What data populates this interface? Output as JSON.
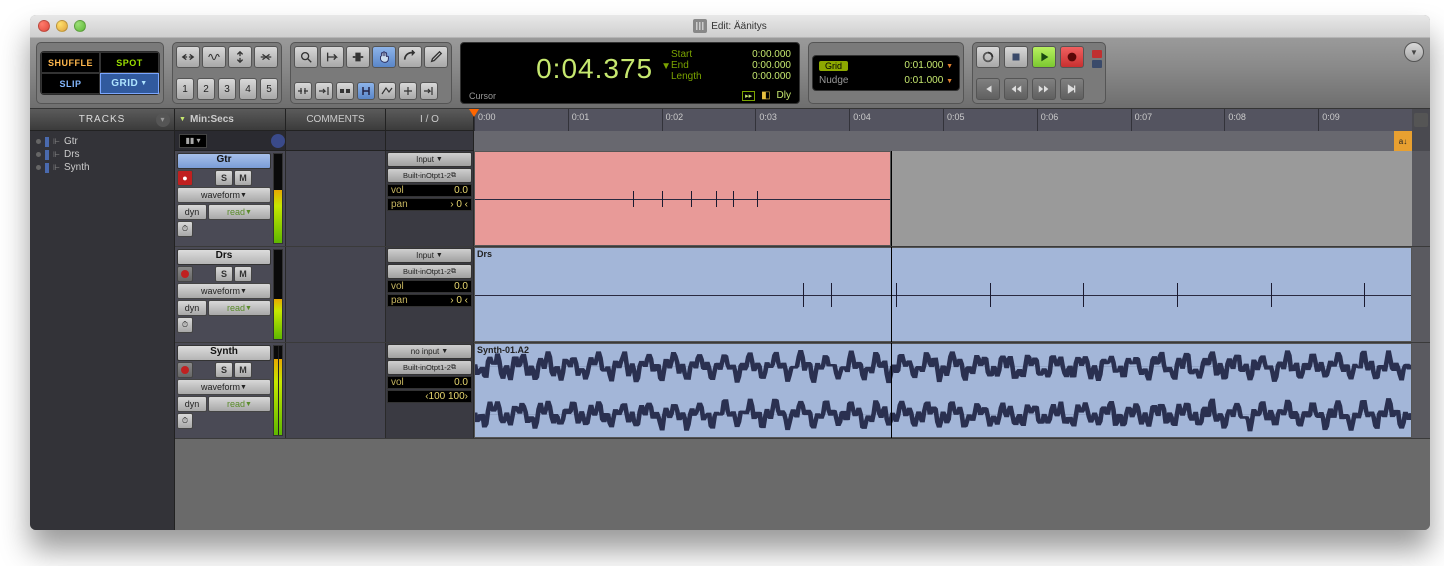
{
  "window": {
    "title": "Edit: Äänitys"
  },
  "modes": {
    "shuffle": "SHUFFLE",
    "spot": "SPOT",
    "slip": "SLIP",
    "grid": "GRID"
  },
  "counter": {
    "main": "0:04.375",
    "start_label": "Start",
    "start": "0:00.000",
    "end_label": "End",
    "end": "0:00.000",
    "length_label": "Length",
    "length": "0:00.000",
    "cursor_label": "Cursor",
    "dly": "Dly"
  },
  "gridbox": {
    "grid_label": "Grid",
    "grid_value": "0:01.000",
    "nudge_label": "Nudge",
    "nudge_value": "0:01.000"
  },
  "mem_locs": [
    "1",
    "2",
    "3",
    "4",
    "5"
  ],
  "columns": {
    "minsecs": "Min:Secs",
    "comments": "COMMENTS",
    "io": "I / O"
  },
  "ruler_ticks": [
    "0:00",
    "0:01",
    "0:02",
    "0:03",
    "0:04",
    "0:05",
    "0:06",
    "0:07",
    "0:08",
    "0:09"
  ],
  "tracks_header": "TRACKS",
  "tracks_list": [
    {
      "name": "Gtr"
    },
    {
      "name": "Drs"
    },
    {
      "name": "Synth"
    }
  ],
  "tracks": [
    {
      "name": "Gtr",
      "record_armed": true,
      "waveform": "waveform",
      "dyn": "dyn",
      "read": "read",
      "io": {
        "input": "Input",
        "output": "Built-inOtpt1-2",
        "vol_label": "vol",
        "vol": "0.0",
        "pan_label": "pan",
        "pan": "› 0 ‹"
      },
      "clip": {
        "start_pct": 0,
        "width_pct": 44.5,
        "color": "red",
        "label": ""
      },
      "meter_pct": 60
    },
    {
      "name": "Drs",
      "record_armed": false,
      "waveform": "waveform",
      "dyn": "dyn",
      "read": "read",
      "io": {
        "input": "Input",
        "output": "Built-inOtpt1-2",
        "vol_label": "vol",
        "vol": "0.0",
        "pan_label": "pan",
        "pan": "› 0 ‹"
      },
      "clip": {
        "start_pct": 0,
        "width_pct": 100,
        "color": "blue",
        "label": "Drs"
      },
      "meter_pct": 45
    },
    {
      "name": "Synth",
      "record_armed": false,
      "waveform": "waveform",
      "dyn": "dyn",
      "read": "read",
      "io": {
        "input": "no input",
        "output": "Built-inOtpt1-2",
        "vol_label": "vol",
        "vol": "0.0",
        "pan2": "‹100   100›"
      },
      "clip": {
        "start_pct": 0,
        "width_pct": 100,
        "color": "blue",
        "label": "Synth-01.A2"
      },
      "meter_pct": 85
    }
  ],
  "playhead_pct": 44.5
}
